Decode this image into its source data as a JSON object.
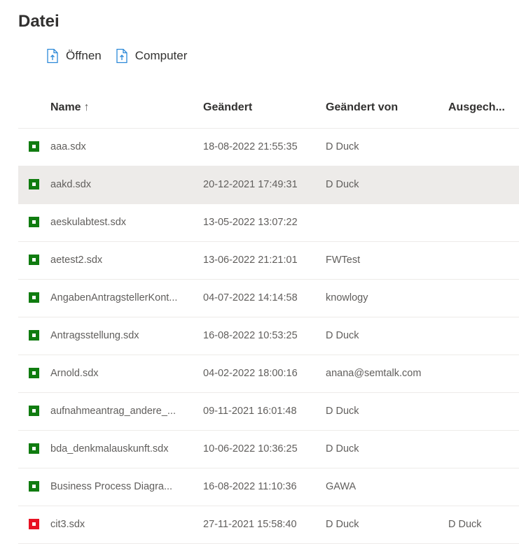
{
  "page": {
    "title": "Datei"
  },
  "toolbar": {
    "open_label": "Öffnen",
    "computer_label": "Computer",
    "icon_color": "#2b88d8"
  },
  "table": {
    "columns": {
      "name": "Name",
      "name_sort_icon": "↑",
      "changed": "Geändert",
      "changed_by": "Geändert von",
      "checked_out": "Ausgech..."
    },
    "status_colors": {
      "ok": "#107c10",
      "locked": "#e81123"
    },
    "rows": [
      {
        "name": "aaa.sdx",
        "changed": "18-08-2022 21:55:35",
        "changed_by": "D Duck",
        "checked_out": "",
        "status": "ok"
      },
      {
        "name": "aakd.sdx",
        "changed": "20-12-2021 17:49:31",
        "changed_by": "D Duck",
        "checked_out": "",
        "status": "ok",
        "selected": true
      },
      {
        "name": "aeskulabtest.sdx",
        "changed": "13-05-2022 13:07:22",
        "changed_by": "",
        "checked_out": "",
        "status": "ok"
      },
      {
        "name": "aetest2.sdx",
        "changed": "13-06-2022 21:21:01",
        "changed_by": "FWTest",
        "checked_out": "",
        "status": "ok"
      },
      {
        "name": "AngabenAntragstellerKont...",
        "changed": "04-07-2022 14:14:58",
        "changed_by": "knowlogy",
        "checked_out": "",
        "status": "ok"
      },
      {
        "name": "Antragsstellung.sdx",
        "changed": "16-08-2022 10:53:25",
        "changed_by": "D Duck",
        "checked_out": "",
        "status": "ok"
      },
      {
        "name": "Arnold.sdx",
        "changed": "04-02-2022 18:00:16",
        "changed_by": "anana@semtalk.com",
        "checked_out": "",
        "status": "ok"
      },
      {
        "name": "aufnahmeantrag_andere_...",
        "changed": "09-11-2021 16:01:48",
        "changed_by": "D Duck",
        "checked_out": "",
        "status": "ok"
      },
      {
        "name": "bda_denkmalauskunft.sdx",
        "changed": "10-06-2022 10:36:25",
        "changed_by": "D Duck",
        "checked_out": "",
        "status": "ok"
      },
      {
        "name": "Business Process Diagra...",
        "changed": "16-08-2022 11:10:36",
        "changed_by": "GAWA",
        "checked_out": "",
        "status": "ok"
      },
      {
        "name": "cit3.sdx",
        "changed": "27-11-2021 15:58:40",
        "changed_by": "D Duck",
        "checked_out": "D Duck",
        "status": "locked"
      }
    ]
  }
}
